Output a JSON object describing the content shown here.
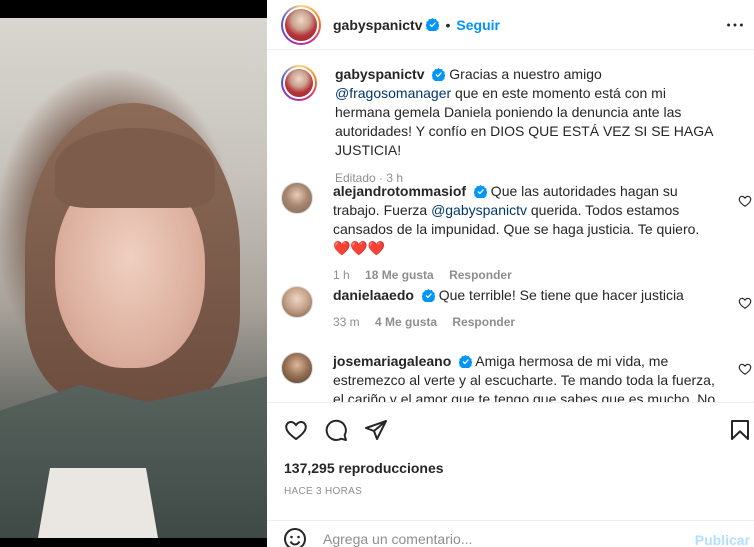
{
  "post": {
    "author": "gabyspanictv",
    "follow_label": "Seguir",
    "dot": "•"
  },
  "caption": {
    "author": "gabyspanictv",
    "text_before": " Gracias a nuestro amigo ",
    "mention": "@fragosomanager",
    "text_after": " que en este momento está con mi hermana gemela Daniela poniendo la denuncia ante las autoridades! Y confío en DIOS QUE ESTÁ VEZ SI SE HAGA JUSTICIA!",
    "edited": "Editado · 3 h"
  },
  "comments": [
    {
      "author": "alejandrotommasiof",
      "text_before": " Que las autoridades hagan su trabajo. Fuerza ",
      "mention": "@gabyspanictv",
      "text_after": " querida. Todos estamos cansados de la impunidad. Que se haga justicia. Te quiero. ",
      "hearts": "❤️❤️❤️",
      "time": "1 h",
      "likes": "18 Me gusta",
      "reply": "Responder"
    },
    {
      "author": "danielaaedo",
      "text": " Que terrible! Se tiene que hacer justicia",
      "time": "33 m",
      "likes": "4 Me gusta",
      "reply": "Responder"
    },
    {
      "author": "josemariagaleano",
      "text": " Amiga hermosa de mi vida, me estremezco al verte y al escucharte. Te mando toda la fuerza, el cariño y el amor que te tengo que sabes que es mucho. No te"
    }
  ],
  "stats": {
    "views": "137,295 reproducciones",
    "time_ago": "HACE 3 HORAS"
  },
  "add_comment": {
    "placeholder": "Agrega un comentario...",
    "post_label": "Publicar"
  },
  "icons": {
    "like": "heart-icon",
    "comment": "comment-icon",
    "share": "send-icon",
    "save": "bookmark-icon",
    "more": "more-dots-icon",
    "emoji": "emoji-icon",
    "verified": "verified-badge-icon"
  },
  "colors": {
    "link_blue": "#0095f6",
    "mention": "#00376b",
    "muted": "#8e8e8e",
    "heart_red": "#ed4956",
    "publish_disabled": "#b2dffc"
  }
}
